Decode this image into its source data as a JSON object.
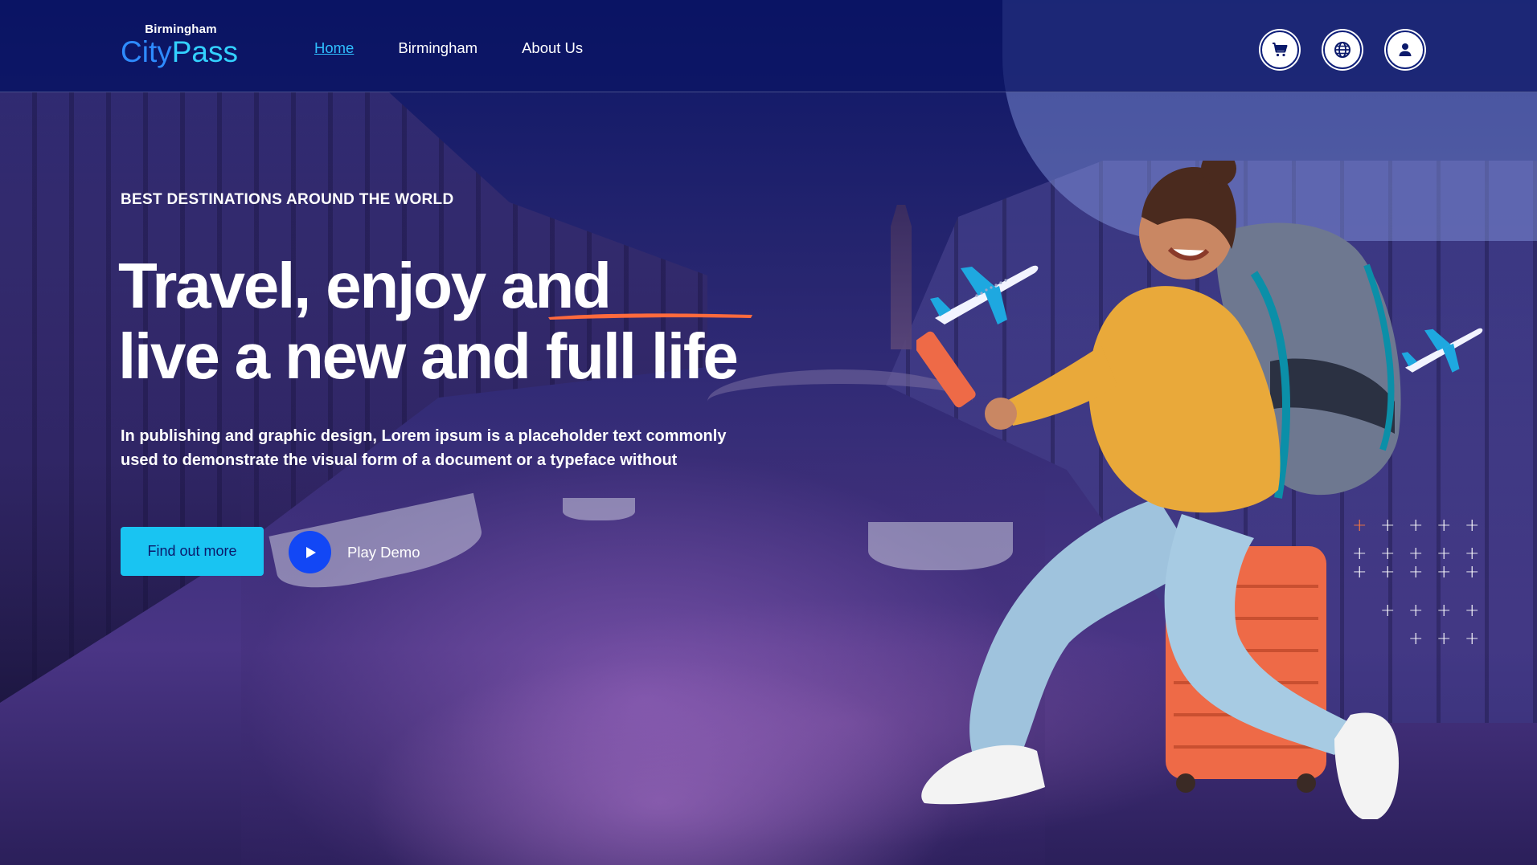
{
  "header": {
    "logo_small": "Birmingham",
    "logo_city": "City",
    "logo_pass": "Pass",
    "nav": [
      {
        "label": "Home",
        "active": true
      },
      {
        "label": "Birmingham",
        "active": false
      },
      {
        "label": "About Us",
        "active": false
      }
    ],
    "icons": [
      "cart-icon",
      "globe-icon",
      "user-icon"
    ]
  },
  "hero": {
    "eyebrow": "BEST DESTINATIONS AROUND THE WORLD",
    "headline_line1": "Travel, enjoy and",
    "headline_line2": "live a new and full life",
    "description": "In publishing and graphic design, Lorem ipsum is a placeholder text commonly used to demonstrate the visual form of a document or a typeface without",
    "cta_label": "Find out more",
    "play_label": "Play Demo"
  },
  "colors": {
    "navy": "#0b1a6b",
    "accent_cyan": "#19c4f2",
    "accent_blue": "#1247f5",
    "link_active": "#2fbfff",
    "underline_orange": "#ff6a3d"
  }
}
